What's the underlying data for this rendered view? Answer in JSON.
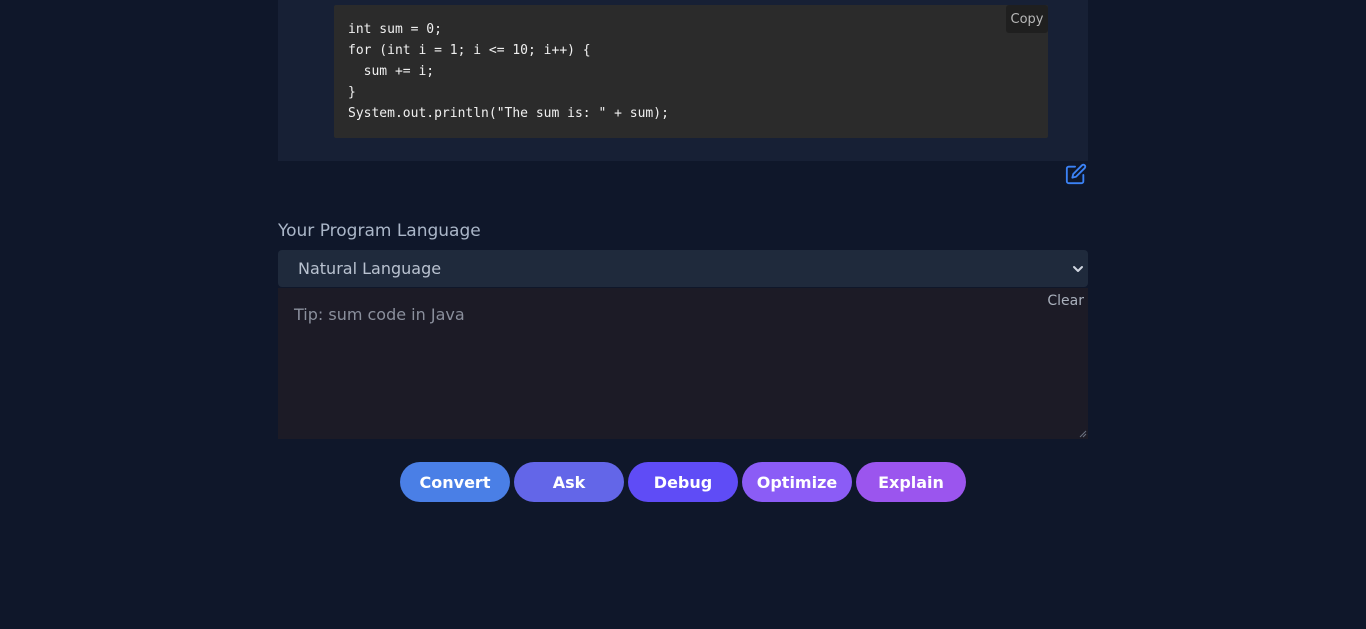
{
  "code_panel": {
    "code": "int sum = 0;\nfor (int i = 1; i <= 10; i++) {\n  sum += i;\n}\nSystem.out.println(\"The sum is: \" + sum);",
    "copy_label": "Copy",
    "edit_icon": "edit-icon"
  },
  "language": {
    "label": "Your Program Language",
    "selected": "Natural Language",
    "chevron_icon": "chevron-down-icon"
  },
  "input": {
    "placeholder": "Tip: sum code in Java",
    "value": "",
    "clear_label": "Clear"
  },
  "actions": [
    {
      "label": "Convert",
      "color": "#4a7fe6"
    },
    {
      "label": "Ask",
      "color": "#6366e8"
    },
    {
      "label": "Debug",
      "color": "#5f4cf6"
    },
    {
      "label": "Optimize",
      "color": "#8b5cf6"
    },
    {
      "label": "Explain",
      "color": "#9b55ee"
    }
  ],
  "colors": {
    "background": "#0f172a",
    "edit_icon": "#3b82f6"
  }
}
